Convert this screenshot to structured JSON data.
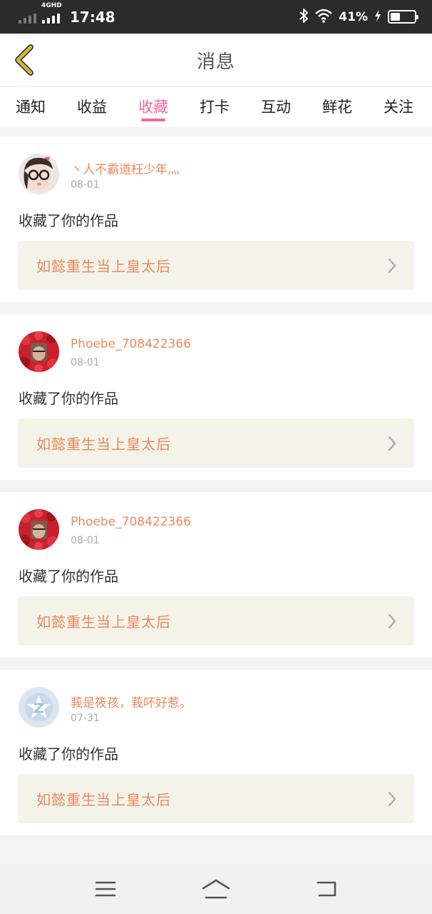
{
  "status_bar": {
    "network": "4GHD",
    "time": "17:48",
    "battery_percent": "41%",
    "battery_level": 0.41,
    "icons": [
      "signal-icon",
      "bluetooth-icon",
      "wifi-icon",
      "charging-icon",
      "battery-icon"
    ]
  },
  "header": {
    "title": "消息",
    "back_icon": "chevron-left-icon"
  },
  "tabs": [
    {
      "label": "通知",
      "active": false
    },
    {
      "label": "收益",
      "active": false
    },
    {
      "label": "收藏",
      "active": true
    },
    {
      "label": "打卡",
      "active": false
    },
    {
      "label": "互动",
      "active": false
    },
    {
      "label": "鲜花",
      "active": false
    },
    {
      "label": "关注",
      "active": false
    }
  ],
  "feed": [
    {
      "username": "丶人不霸道枉少年灬",
      "date": "08-01",
      "action": "收藏了你的作品",
      "work_title": "如懿重生当上皇太后",
      "avatar": "avatar-glasses-girl"
    },
    {
      "username": "Phoebe_708422366",
      "date": "08-01",
      "action": "收藏了你的作品",
      "work_title": "如懿重生当上皇太后",
      "avatar": "avatar-rose-portrait"
    },
    {
      "username": "Phoebe_708422366",
      "date": "08-01",
      "action": "收藏了你的作品",
      "work_title": "如懿重生当上皇太后",
      "avatar": "avatar-rose-portrait"
    },
    {
      "username": "莪是筱孩，莪吥好惹。",
      "date": "07-31",
      "action": "收藏了你的作品",
      "work_title": "如懿重生当上皇太后",
      "avatar": "avatar-default-z"
    }
  ],
  "colors": {
    "accent_pink": "#e86a9f",
    "username_orange": "#ea8a5d",
    "card_highlight_bg": "#f4f3ea",
    "back_chevron": "#c9b13a"
  },
  "nav_bar": {
    "icons": [
      "menu-icon",
      "home-icon",
      "back-icon"
    ]
  }
}
